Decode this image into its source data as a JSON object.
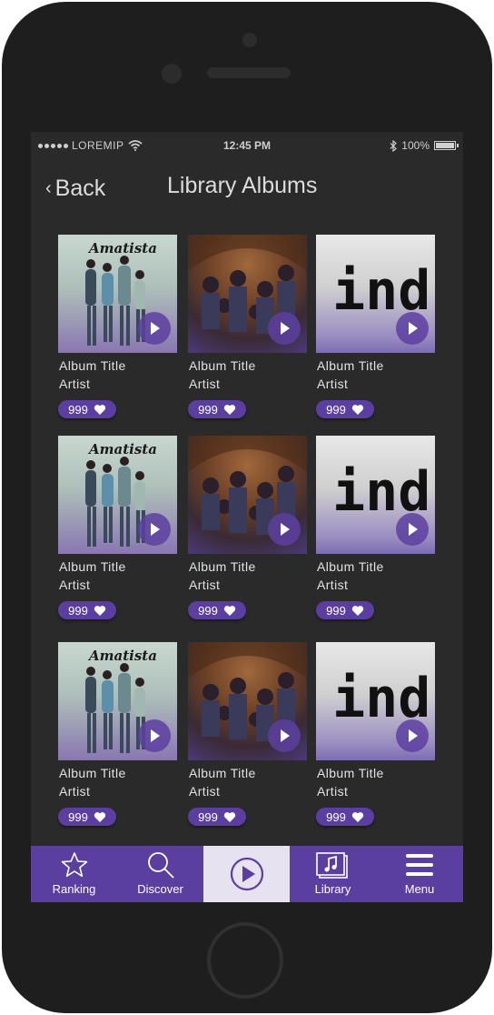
{
  "status_bar": {
    "carrier": "LOREMIP",
    "time": "12:45 PM",
    "battery": "100%"
  },
  "nav": {
    "back_label": "Back",
    "title": "Library Albums"
  },
  "albums": [
    {
      "title": "Album Title",
      "artist": "Artist",
      "likes": "999",
      "cover": "amatista",
      "cover_text": "Amatista"
    },
    {
      "title": "Album Title",
      "artist": "Artist",
      "likes": "999",
      "cover": "band-photo"
    },
    {
      "title": "Album Title",
      "artist": "Artist",
      "likes": "999",
      "cover": "ind",
      "cover_text": "ind"
    },
    {
      "title": "Album Title",
      "artist": "Artist",
      "likes": "999",
      "cover": "amatista",
      "cover_text": "Amatista"
    },
    {
      "title": "Album Title",
      "artist": "Artist",
      "likes": "999",
      "cover": "band-photo"
    },
    {
      "title": "Album Title",
      "artist": "Artist",
      "likes": "999",
      "cover": "ind",
      "cover_text": "ind"
    },
    {
      "title": "Album Title",
      "artist": "Artist",
      "likes": "999",
      "cover": "amatista",
      "cover_text": "Amatista"
    },
    {
      "title": "Album Title",
      "artist": "Artist",
      "likes": "999",
      "cover": "band-photo"
    },
    {
      "title": "Album Title",
      "artist": "Artist",
      "likes": "999",
      "cover": "ind",
      "cover_text": "ind"
    }
  ],
  "tab_bar": {
    "ranking": "Ranking",
    "discover": "Discover",
    "library": "Library",
    "menu": "Menu"
  },
  "colors": {
    "accent": "#5b3fa0",
    "background": "#2b2a2b",
    "phone": "#1e1e1e",
    "play_tab": "#e7e2ef"
  },
  "icons": [
    "star-icon",
    "search-icon",
    "play-icon",
    "music-note-icon",
    "hamburger-menu-icon",
    "heart-icon",
    "wifi-icon",
    "bluetooth-icon",
    "battery-icon",
    "chevron-left-icon"
  ]
}
